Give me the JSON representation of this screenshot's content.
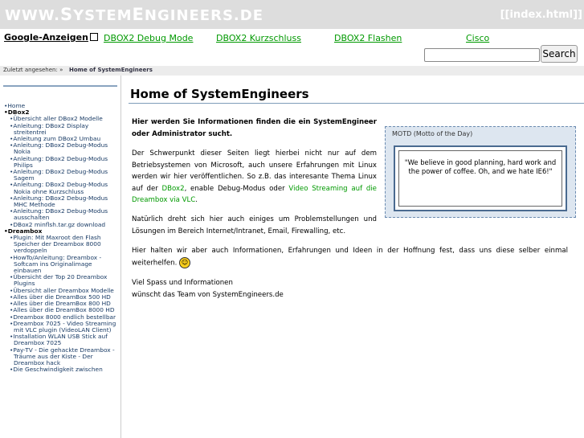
{
  "header": {
    "logo_first": "WWW.",
    "logo_s": "S",
    "logo_mid": "YSTEM",
    "logo_e": "E",
    "logo_end": "NGINEERS.DE",
    "index_link": "[[index.html]]"
  },
  "adbar": {
    "ads_label": "Google-Anzeigen",
    "links": [
      "DBOX2 Debug Mode",
      "DBOX2 Kurzschluss",
      "DBOX2 Flashen",
      "Cisco"
    ],
    "search_placeholder": "",
    "search_button": "Search"
  },
  "breadcrumb": {
    "label": "Zuletzt angesehen: »",
    "current": "Home of SystemEngineers"
  },
  "sidebar": {
    "home": "Home",
    "dbox2_head": "DBox2",
    "dbox2_items": [
      "Übersicht aller DBox2 Modelle",
      "Anleitung: DBox2 Display streitentrei",
      "Anleitung zum DBox2 Umbau",
      "Anleitung: DBox2 Debug-Modus Nokia",
      "Anleitung: DBox2 Debug-Modus Philips",
      "Anleitung: DBox2 Debug-Modus Sagem",
      "Anleitung: DBox2 Debug-Modus Nokia ohne Kurzschluss",
      "Anleitung: DBox2 Debug-Modus MHC Methode",
      "Anleitung: DBox2 Debug-Modus ausschalten",
      "DBox2 minflsh.tar.gz download"
    ],
    "dreambox_head": "Dreambox",
    "dreambox_items": [
      "Plugin: Mit Maxroot den Flash Speicher der Dreambox 8000 verdoppeln",
      "HowTo/Anleitung: Dreambox - Softcam ins Originalimage einbauen",
      "Übersicht der Top 20 Dreambox Plugins",
      "Übersicht aller Dreambox Modelle",
      "Alles über die DreamBox 500 HD",
      "Alles über die DreamBox 800 HD",
      "Alles über die DreamBox 8000 HD",
      "Dreambox 8000 endlich bestellbar",
      "Dreambox 7025 - Video Streaming mit VLC plugin (VideoLAN Client)",
      "Installation WLAN USB Stick auf Dreambox 7025",
      "Pay-TV - Die gehackte Dreambox - Träume aus der Kiste - Der Dreambox hack",
      "Die Geschwindigkeit zwischen"
    ]
  },
  "content": {
    "title": "Home of SystemEngineers",
    "intro": "Hier werden Sie Informationen finden die ein SystemEngineer oder Administrator sucht.",
    "p1_a": "Der Schwerpunkt dieser Seiten liegt hierbei nicht nur auf dem Betriebsystemen von Microsoft, auch unsere Erfahrungen mit Linux werden wir hier veröffentlichen. So z.B. das interesante Thema Linux auf der ",
    "p1_link1": "DBox2",
    "p1_b": ", enable Debug-Modus oder ",
    "p1_link2": "Video Streaming auf die Dreambox via VLC",
    "p1_c": ".",
    "p2": "Natürlich dreht sich hier auch einiges um Problemstellungen und Lösungen im Bereich Internet/Intranet, Email, Firewalling, etc.",
    "p3": "Hier halten wir aber auch Informationen, Erfahrungen und Ideen in der Hoffnung fest, dass uns diese selber einmal weiterhelfen.",
    "p4_line1": "Viel Spass und Informationen",
    "p4_line2": "wünscht das Team von SystemEngineers.de"
  },
  "motd": {
    "title": "MOTD (Motto of the Day)",
    "quote": "\"We believe in good planning, hard work and the power of coffee. Oh, and we hate IE6!\""
  },
  "colors": {
    "header_bg": "#dddddd",
    "link_green": "#009900",
    "sidebar_link": "#1a3c66",
    "motd_bg": "#dde6f0"
  }
}
